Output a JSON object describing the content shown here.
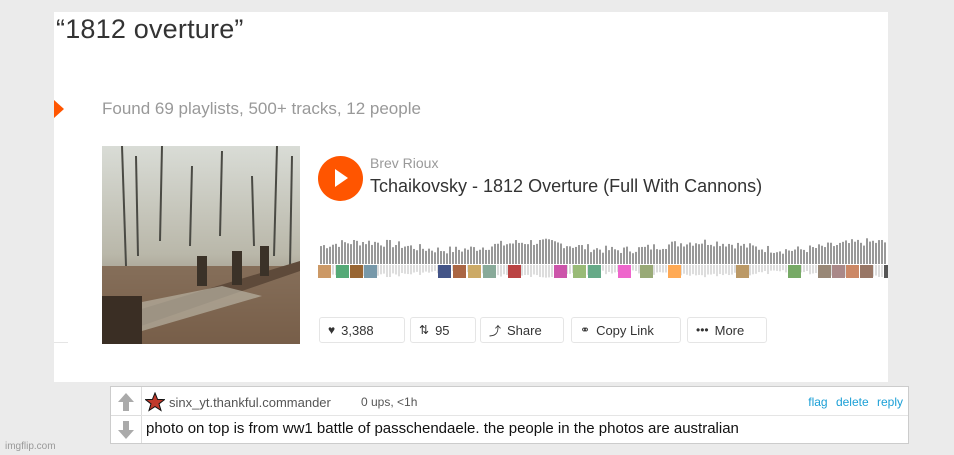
{
  "search": {
    "title": "“1812 overture”"
  },
  "results": {
    "summary": "Found 69 playlists, 500+ tracks, 12 people"
  },
  "track": {
    "user": "Brev Rioux",
    "title": "Tchaikovsky - 1812 Overture (Full With Cannons)",
    "likes": "3,388",
    "reposts": "95",
    "share_label": "Share",
    "copy_link_label": "Copy Link",
    "more_label": "More"
  },
  "comment": {
    "username": "sinx_yt.thankful.commander",
    "meta": "0 ups, <1h",
    "flag_label": "flag",
    "delete_label": "delete",
    "reply_label": "reply",
    "text": "photo on top is from ww1 battle of passchendaele. the people in the photos are australian"
  },
  "watermark": "imgflip.com",
  "colors": {
    "accent": "#ff5500",
    "link": "#1a9fd6"
  }
}
